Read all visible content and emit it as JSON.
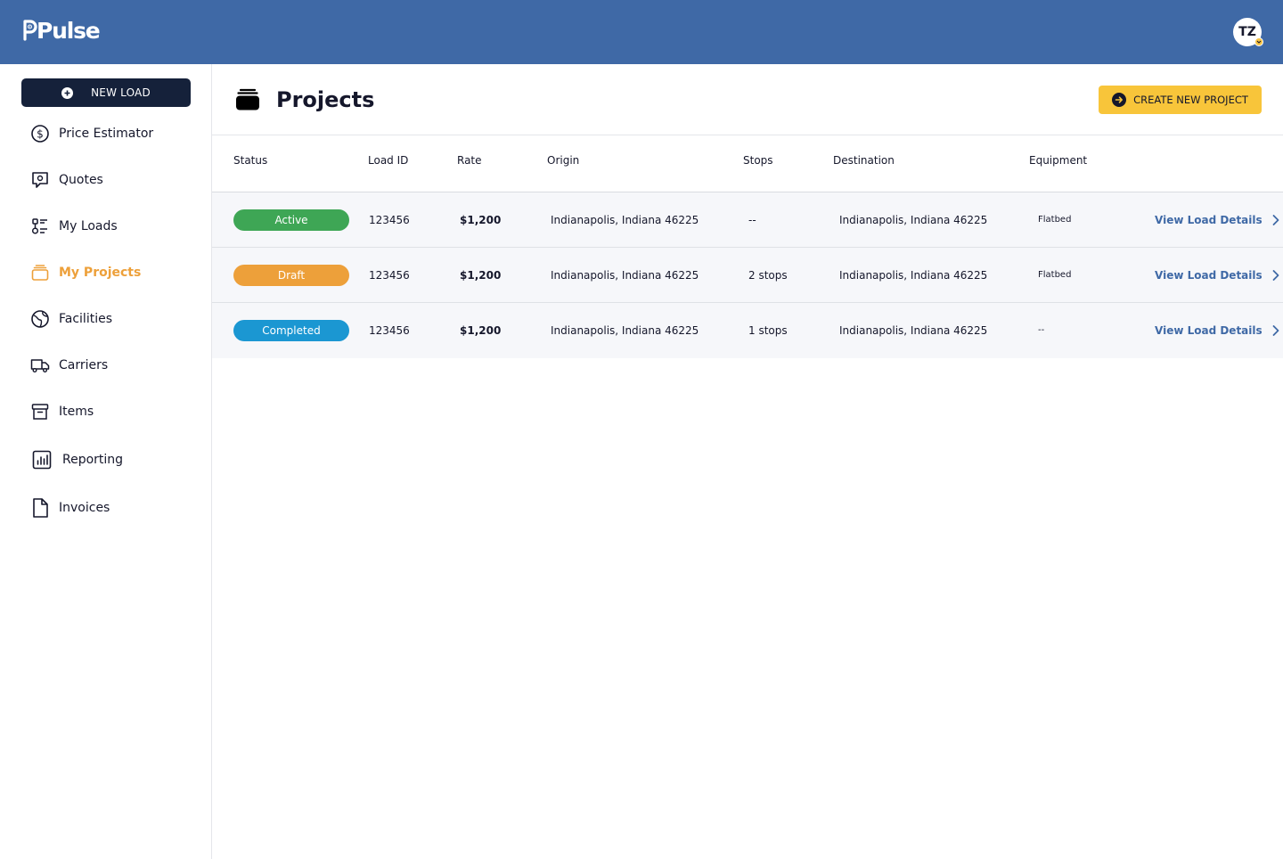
{
  "app": {
    "brand": "Pulse",
    "user_initials": "TZ"
  },
  "sidebar": {
    "new_load_label": "NEW LOAD",
    "items": [
      {
        "label": "Price Estimator",
        "icon": "dollar-circle-icon"
      },
      {
        "label": "Quotes",
        "icon": "quote-bubble-icon"
      },
      {
        "label": "My Loads",
        "icon": "loads-list-icon"
      },
      {
        "label": "My Projects",
        "icon": "projects-box-icon",
        "active": true
      },
      {
        "label": "Facilities",
        "icon": "globe-icon"
      },
      {
        "label": "Carriers",
        "icon": "truck-icon"
      },
      {
        "label": "Items",
        "icon": "archive-box-icon"
      },
      {
        "label": "Reporting",
        "icon": "bar-chart-icon"
      },
      {
        "label": "Invoices",
        "icon": "document-icon"
      }
    ]
  },
  "main": {
    "title": "Projects",
    "create_button_label": "CREATE NEW PROJECT",
    "table": {
      "headers": [
        "Status",
        "Load ID",
        "Rate",
        "Origin",
        "Stops",
        "Destination",
        "Equipment"
      ],
      "rows": [
        {
          "status": "Active",
          "status_color": "#3ea655",
          "load_id": "123456",
          "rate": "$1,200",
          "origin": "Indianapolis, Indiana 46225",
          "stops": "--",
          "destination": "Indianapolis, Indiana 46225",
          "equipment": "Flatbed",
          "action": "View Load Details"
        },
        {
          "status": "Draft",
          "status_color": "#eda03a",
          "load_id": "123456",
          "rate": "$1,200",
          "origin": "Indianapolis, Indiana 46225",
          "stops": "2 stops",
          "destination": "Indianapolis, Indiana 46225",
          "equipment": "Flatbed",
          "action": "View Load Details"
        },
        {
          "status": "Completed",
          "status_color": "#1b97d2",
          "load_id": "123456",
          "rate": "$1,200",
          "origin": "Indianapolis, Indiana 46225",
          "stops": "1 stops",
          "destination": "Indianapolis, Indiana 46225",
          "equipment": "--",
          "action": "View Load Details"
        }
      ]
    }
  },
  "colors": {
    "topbar": "#3f69a6",
    "accent": "#eda03a",
    "create_button": "#f8c53a",
    "new_load_button": "#15213a",
    "link": "#3f69a6"
  }
}
